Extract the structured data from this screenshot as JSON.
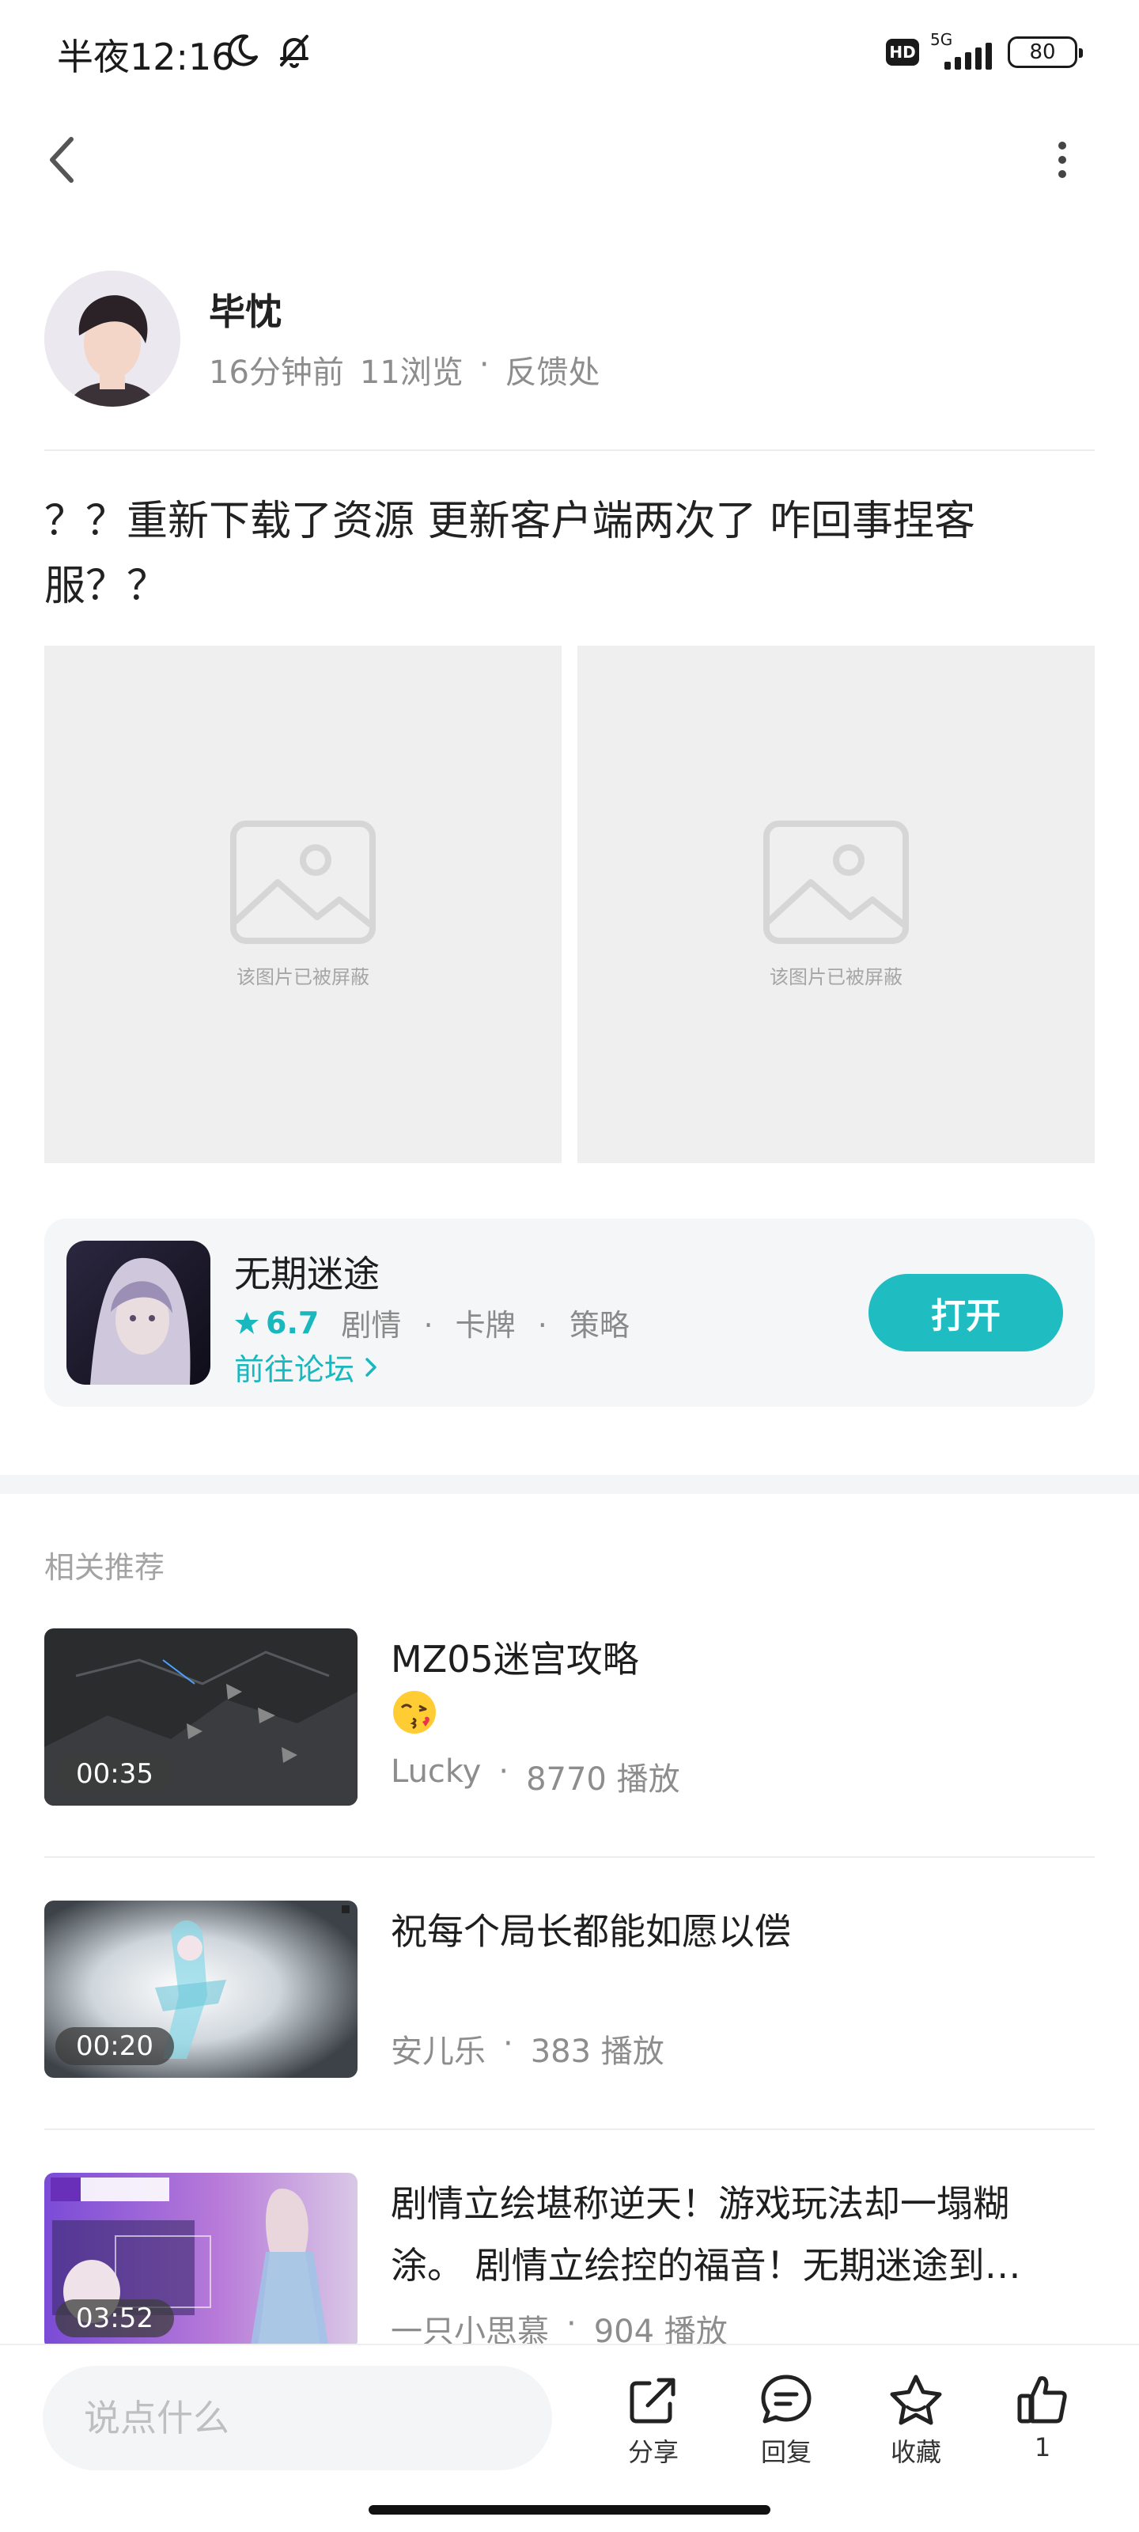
{
  "status_bar": {
    "time": "半夜12:16",
    "network": "5G",
    "hd_badge": "HD",
    "battery": "80"
  },
  "author": {
    "name": "毕忱",
    "time_ago": "16分钟前",
    "views": "11浏览",
    "separator": "·",
    "section": "反馈处"
  },
  "post": {
    "text": "？？重新下载了资源 更新客户端两次了 咋回事捏客服？？",
    "images": [
      {
        "caption": "该图片已被屏蔽"
      },
      {
        "caption": "该图片已被屏蔽"
      }
    ]
  },
  "game_card": {
    "name": "无期迷途",
    "rating": "6.7",
    "tags": [
      "剧情",
      "卡牌",
      "策略"
    ],
    "tag_separator": "·",
    "forum_link": "前往论坛",
    "open_button": "打开",
    "accent_color": "#1fbcc2"
  },
  "recommendations": {
    "section_title": "相关推荐",
    "items": [
      {
        "title": "MZ05迷宫攻略",
        "has_emoji": true,
        "emoji": "kissing-face",
        "author": "Lucky",
        "plays": "8770 播放",
        "duration": "00:35"
      },
      {
        "title": "祝每个局长都能如愿以偿",
        "author": "安儿乐",
        "plays": "383 播放",
        "duration": "00:20"
      },
      {
        "title_line1": "剧情立绘堪称逆天！游戏玩法却一塌糊",
        "title_line2": "涂。 剧情立绘控的福音！无期迷途到…",
        "author": "一只小思慕",
        "plays": "904 播放",
        "duration": "03:52"
      }
    ]
  },
  "bottom_bar": {
    "comment_placeholder": "说点什么",
    "share_label": "分享",
    "reply_label": "回复",
    "favorite_label": "收藏",
    "like_count": "1"
  }
}
